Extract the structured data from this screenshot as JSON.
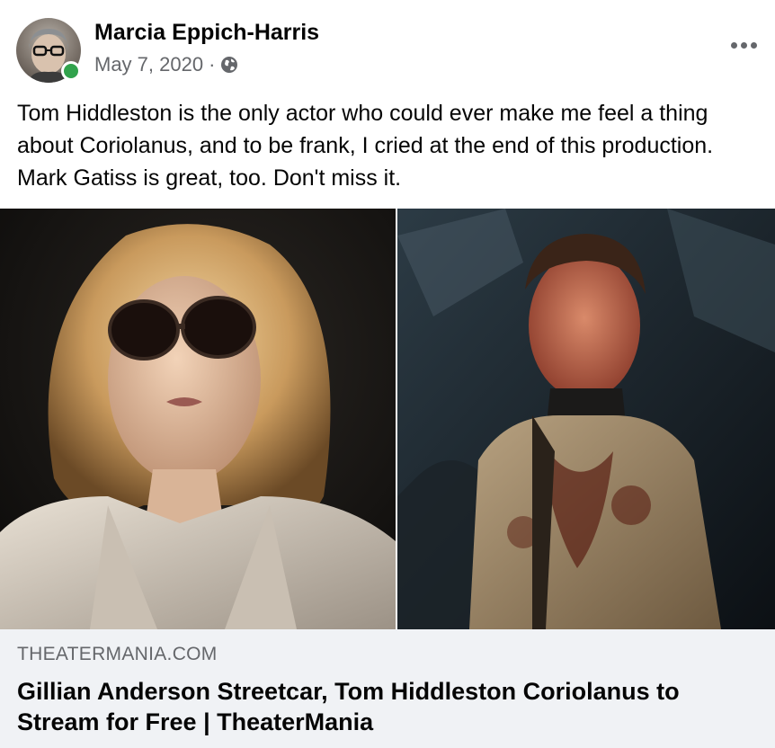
{
  "post": {
    "author": "Marcia Eppich-Harris",
    "date": "May 7, 2020",
    "separator": "·",
    "privacy_icon": "globe-icon",
    "more_icon": "more-options-icon",
    "text": "Tom Hiddleston is the only actor who could ever make me feel a thing about Coriolanus, and to be frank, I cried at the end of this production. Mark Gatiss is great, too. Don't miss it."
  },
  "link_preview": {
    "domain": "THEATERMANIA.COM",
    "title": "Gillian Anderson Streetcar, Tom Hiddleston Coriolanus to Stream for Free | TheaterMania"
  },
  "colors": {
    "online": "#31a24c",
    "secondary_text": "#65676b",
    "link_bg": "#f0f2f5"
  }
}
